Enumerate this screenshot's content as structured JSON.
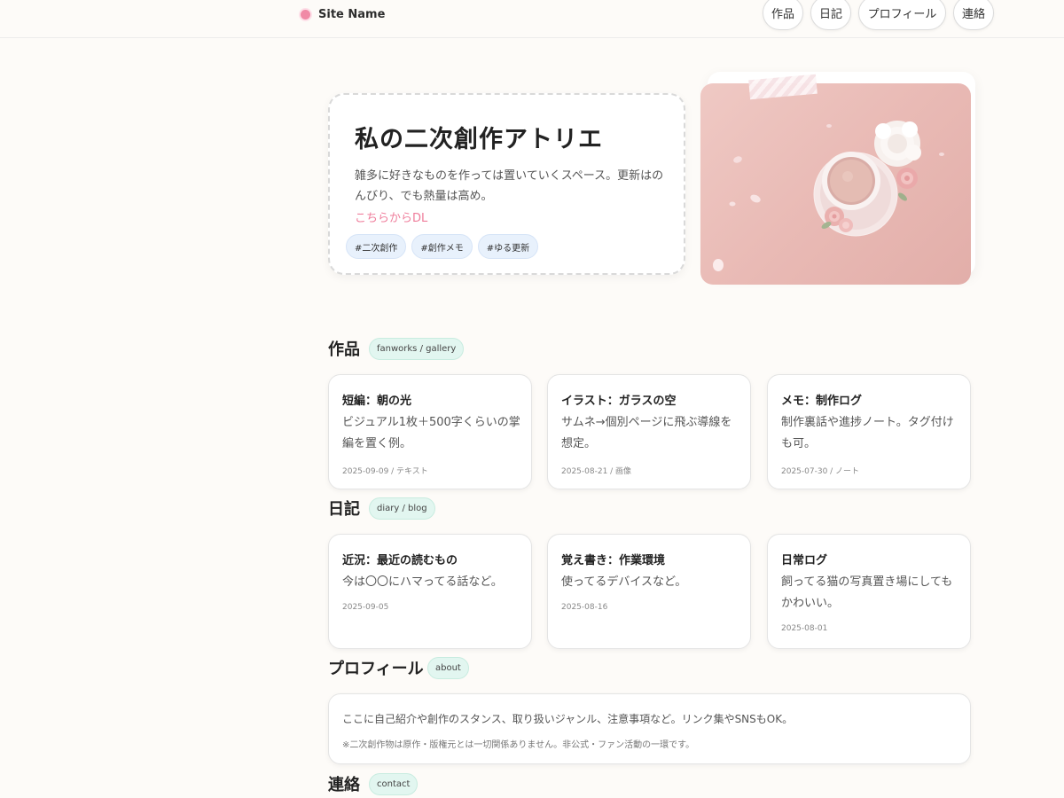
{
  "header": {
    "site_name": "Site Name",
    "nav": [
      "作品",
      "日記",
      "プロフィール",
      "連絡"
    ]
  },
  "hero": {
    "title": "私の二次創作アトリエ",
    "description": "雑多に好きなものを作っては置いていくスペース。更新はのんびり、でも熱量は高め。",
    "link": "こちらからDL",
    "tags": [
      "#二次創作",
      "#創作メモ",
      "#ゆる更新"
    ],
    "image_icon": "coffee-cup-flowers-image"
  },
  "works": {
    "title": "作品",
    "badge": "fanworks / gallery",
    "cards": [
      {
        "title": "短編：朝の光",
        "desc": "ビジュアル1枚＋500字くらいの掌編を置く例。",
        "meta": "2025-09-09 / テキスト"
      },
      {
        "title": "イラスト：ガラスの空",
        "desc": "サムネ→個別ページに飛ぶ導線を想定。",
        "meta": "2025-08-21 / 画像"
      },
      {
        "title": "メモ：制作ログ",
        "desc": "制作裏話や進捗ノート。タグ付けも可。",
        "meta": "2025-07-30 / ノート"
      }
    ]
  },
  "diary": {
    "title": "日記",
    "badge": "diary / blog",
    "cards": [
      {
        "title": "近況：最近の読むもの",
        "desc": "今は〇〇にハマってる話など。",
        "meta": "2025-09-05"
      },
      {
        "title": "覚え書き：作業環境",
        "desc": "使ってるデバイスなど。",
        "meta": "2025-08-16"
      },
      {
        "title": "日常ログ",
        "desc": "飼ってる猫の写真置き場にしてもかわいい。",
        "meta": "2025-08-01"
      }
    ]
  },
  "profile": {
    "title": "プロフィール",
    "badge": "about",
    "text": "ここに自己紹介や創作のスタンス、取り扱いジャンル、注意事項など。リンク集やSNSもOK。",
    "note": "※二次創作物は原作・版権元とは一切関係ありません。非公式・ファン活動の一環です。"
  },
  "contact": {
    "title": "連絡",
    "badge": "contact"
  },
  "colors": {
    "background": "#fdfbf8",
    "accent_pink": "#ef7d9b",
    "tag_blue": "#e8f1fc",
    "badge_mint": "#e2f6f0"
  }
}
